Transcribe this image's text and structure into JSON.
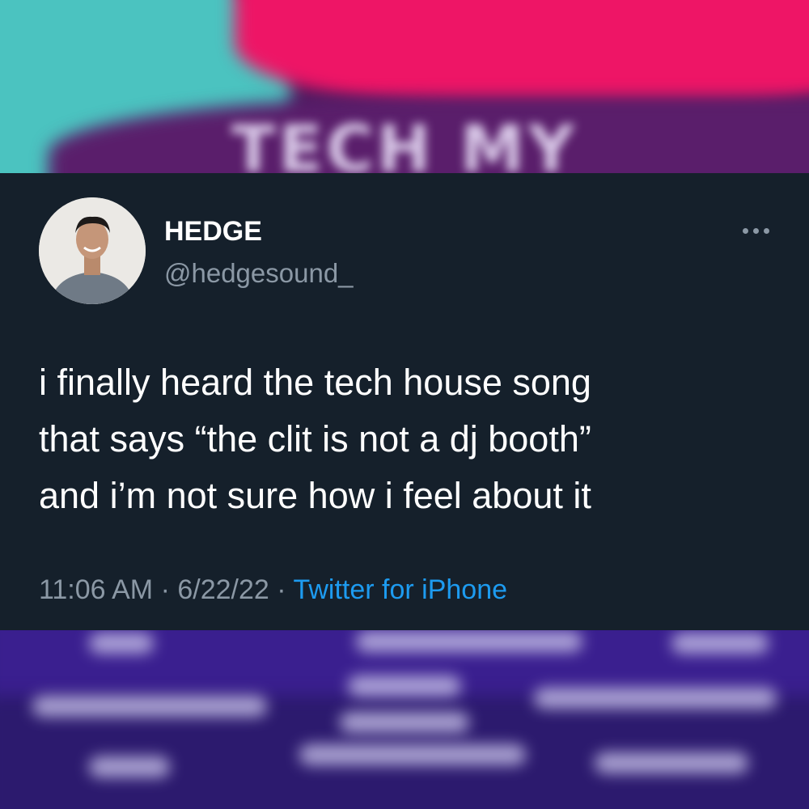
{
  "background": {
    "poster_title": "TECH MY HOUSE",
    "colors": {
      "teal": "#4bc3c0",
      "pink": "#ee1566",
      "purple": "#5a1e6b",
      "blue_violet": "#3a1f8f"
    }
  },
  "tweet": {
    "display_name": "HEDGE",
    "handle": "@hedgesound_",
    "more_icon": "more-horizontal-icon",
    "lines": [
      "i finally heard the tech house song",
      "that says “the clit is not a dj booth”",
      "and i’m not sure how i feel about it"
    ],
    "time": "11:06 AM",
    "separator": "·",
    "date": "6/22/22",
    "source": "Twitter for iPhone",
    "colors": {
      "card_bg": "#15202b",
      "muted": "#8b98a5",
      "link": "#1d9bf0"
    }
  }
}
